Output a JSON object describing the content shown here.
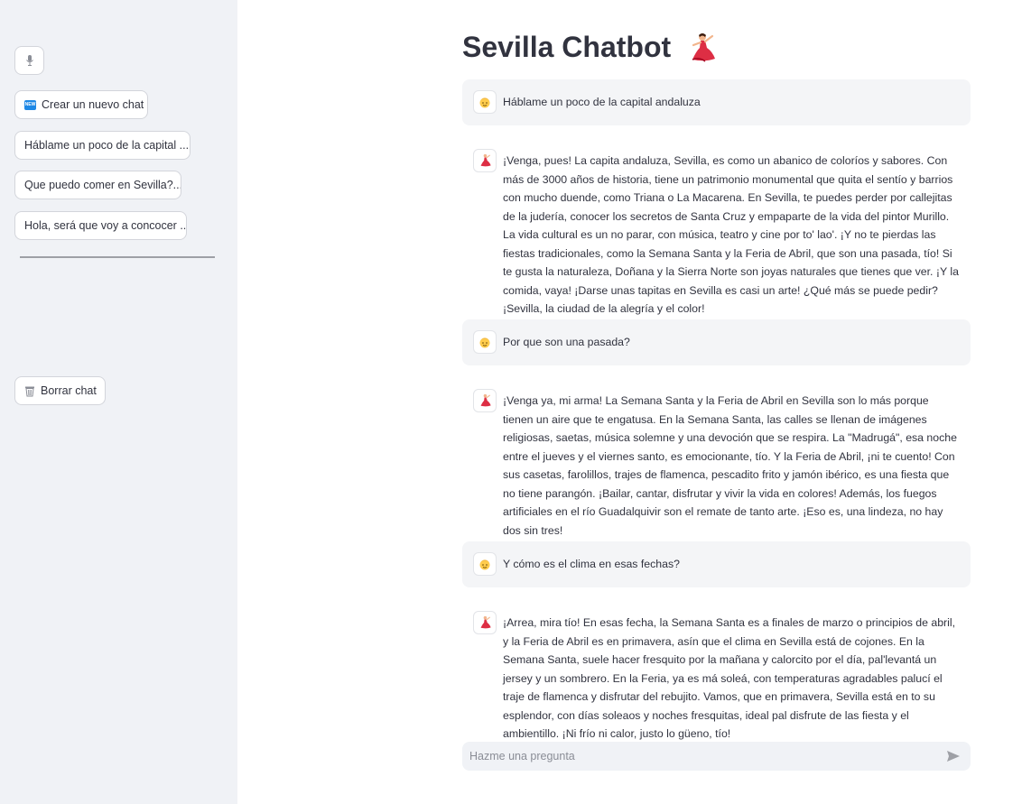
{
  "sidebar": {
    "new_chat_label": "Crear un nuevo chat",
    "history": [
      "Háblame un poco de la capital ...",
      "Que puedo comer en Sevilla?...",
      "Hola, será que voy a concocer ..."
    ],
    "clear_label": "Borrar chat"
  },
  "main": {
    "title": "Sevilla Chatbot",
    "messages": [
      {
        "role": "user",
        "text": "Háblame un poco de la capital andaluza"
      },
      {
        "role": "assistant",
        "text": "¡Venga, pues! La capita andaluza, Sevilla, es como un abanico de coloríos y sabores. Con más de 3000 años de historia, tiene un patrimonio monumental que quita el sentío y barrios con mucho duende, como Triana o La Macarena. En Sevilla, te puedes perder por callejitas de la judería, conocer los secretos de Santa Cruz y empaparte de la vida del pintor Murillo. La vida cultural es un no parar, con música, teatro y cine por to' lao'. ¡Y no te pierdas las fiestas tradicionales, como la Semana Santa y la Feria de Abril, que son una pasada, tío! Si te gusta la naturaleza, Doñana y la Sierra Norte son joyas naturales que tienes que ver. ¡Y la comida, vaya! ¡Darse unas tapitas en Sevilla es casi un arte! ¿Qué más se puede pedir? ¡Sevilla, la ciudad de la alegría y el color!"
      },
      {
        "role": "user",
        "text": "Por que son una pasada?"
      },
      {
        "role": "assistant",
        "text": "¡Venga ya, mi arma! La Semana Santa y la Feria de Abril en Sevilla son lo más porque tienen un aire que te engatusa. En la Semana Santa, las calles se llenan de imágenes religiosas, saetas, música solemne y una devoción que se respira. La \"Madrugá\", esa noche entre el jueves y el viernes santo, es emocionante, tío. Y la Feria de Abril, ¡ni te cuento! Con sus casetas, farolillos, trajes de flamenca, pescadito frito y jamón ibérico, es una fiesta que no tiene parangón. ¡Bailar, cantar, disfrutar y vivir la vida en colores! Además, los fuegos artificiales en el río Guadalquivir son el remate de tanto arte. ¡Eso es, una lindeza, no hay dos sin tres!"
      },
      {
        "role": "user",
        "text": "Y cómo es el clima en esas fechas?"
      },
      {
        "role": "assistant",
        "text": "¡Arrea, mira tío! En esas fecha, la Semana Santa es a finales de marzo o principios de abril, y la Feria de Abril es en primavera, asín que el clima en Sevilla está de cojones. En la Semana Santa, suele hacer fresquito por la mañana y calorcito por el día, pal'levantá un jersey y un sombrero. En la Feria, ya es má soleá, con temperaturas agradables palucí el traje de flamenca y disfrutar del rebujito. Vamos, que en primavera, Sevilla está en to su esplendor, con días soleaos y noches fresquitas, ideal pal disfrute de las fiesta y el ambientillo. ¡Ni frío ni calor, justo lo güeno, tío!"
      }
    ],
    "input_placeholder": "Hazme una pregunta"
  },
  "colors": {
    "sidebar_bg": "#f0f2f6",
    "user_bubble_bg": "#f4f5f7",
    "text": "#31333f"
  }
}
